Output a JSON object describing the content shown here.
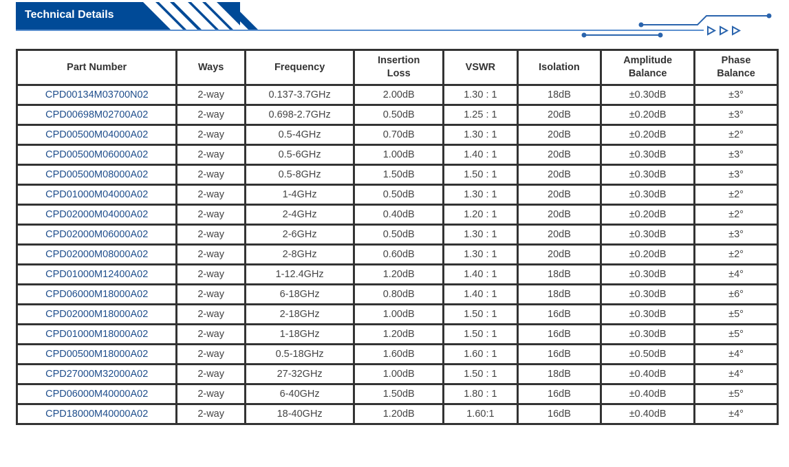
{
  "section": {
    "title": "Technical Details",
    "accent_color": "#004a97",
    "decoration_icons": [
      "stripes-decoration",
      "circuit-line-decoration",
      "triangle-arrow-icon",
      "triangle-arrow-icon",
      "triangle-arrow-icon"
    ]
  },
  "table": {
    "headers": [
      "Part  Number",
      "Ways",
      "Frequency",
      "Insertion Loss",
      "VSWR",
      "Isolation",
      "Amplitude Balance",
      "Phase Balance"
    ],
    "rows": [
      {
        "part": "CPD00134M03700N02",
        "ways": "2-way",
        "freq": "0.137-3.7GHz",
        "il": "2.00dB",
        "vswr": "1.30 : 1",
        "iso": "18dB",
        "amp": "±0.30dB",
        "phase": "±3°"
      },
      {
        "part": "CPD00698M02700A02",
        "ways": "2-way",
        "freq": "0.698-2.7GHz",
        "il": "0.50dB",
        "vswr": "1.25 : 1",
        "iso": "20dB",
        "amp": "±0.20dB",
        "phase": "±3°"
      },
      {
        "part": "CPD00500M04000A02",
        "ways": "2-way",
        "freq": "0.5-4GHz",
        "il": "0.70dB",
        "vswr": "1.30 : 1",
        "iso": "20dB",
        "amp": "±0.20dB",
        "phase": "±2°"
      },
      {
        "part": "CPD00500M06000A02",
        "ways": "2-way",
        "freq": "0.5-6GHz",
        "il": "1.00dB",
        "vswr": "1.40 : 1",
        "iso": "20dB",
        "amp": "±0.30dB",
        "phase": "±3°"
      },
      {
        "part": "CPD00500M08000A02",
        "ways": "2-way",
        "freq": "0.5-8GHz",
        "il": "1.50dB",
        "vswr": "1.50 : 1",
        "iso": "20dB",
        "amp": "±0.30dB",
        "phase": "±3°"
      },
      {
        "part": "CPD01000M04000A02",
        "ways": "2-way",
        "freq": "1-4GHz",
        "il": "0.50dB",
        "vswr": "1.30 : 1",
        "iso": "20dB",
        "amp": "±0.30dB",
        "phase": "±2°"
      },
      {
        "part": "CPD02000M04000A02",
        "ways": "2-way",
        "freq": "2-4GHz",
        "il": "0.40dB",
        "vswr": "1.20 : 1",
        "iso": "20dB",
        "amp": "±0.20dB",
        "phase": "±2°"
      },
      {
        "part": "CPD02000M06000A02",
        "ways": "2-way",
        "freq": "2-6GHz",
        "il": "0.50dB",
        "vswr": "1.30 : 1",
        "iso": "20dB",
        "amp": "±0.30dB",
        "phase": "±3°"
      },
      {
        "part": "CPD02000M08000A02",
        "ways": "2-way",
        "freq": "2-8GHz",
        "il": "0.60dB",
        "vswr": "1.30 : 1",
        "iso": "20dB",
        "amp": "±0.20dB",
        "phase": "±2°"
      },
      {
        "part": "CPD01000M12400A02",
        "ways": "2-way",
        "freq": "1-12.4GHz",
        "il": "1.20dB",
        "vswr": "1.40 : 1",
        "iso": "18dB",
        "amp": "±0.30dB",
        "phase": "±4°"
      },
      {
        "part": "CPD06000M18000A02",
        "ways": "2-way",
        "freq": "6-18GHz",
        "il": "0.80dB",
        "vswr": "1.40 : 1",
        "iso": "18dB",
        "amp": "±0.30dB",
        "phase": "±6°"
      },
      {
        "part": "CPD02000M18000A02",
        "ways": "2-way",
        "freq": "2-18GHz",
        "il": "1.00dB",
        "vswr": "1.50 : 1",
        "iso": "16dB",
        "amp": "±0.30dB",
        "phase": "±5°"
      },
      {
        "part": "CPD01000M18000A02",
        "ways": "2-way",
        "freq": "1-18GHz",
        "il": "1.20dB",
        "vswr": "1.50 : 1",
        "iso": "16dB",
        "amp": "±0.30dB",
        "phase": "±5°"
      },
      {
        "part": "CPD00500M18000A02",
        "ways": "2-way",
        "freq": "0.5-18GHz",
        "il": "1.60dB",
        "vswr": "1.60 : 1",
        "iso": "16dB",
        "amp": "±0.50dB",
        "phase": "±4°"
      },
      {
        "part": "CPD27000M32000A02",
        "ways": "2-way",
        "freq": "27-32GHz",
        "il": "1.00dB",
        "vswr": "1.50 : 1",
        "iso": "18dB",
        "amp": "±0.40dB",
        "phase": "±4°"
      },
      {
        "part": "CPD06000M40000A02",
        "ways": "2-way",
        "freq": "6-40GHz",
        "il": "1.50dB",
        "vswr": "1.80 : 1",
        "iso": "16dB",
        "amp": "±0.40dB",
        "phase": "±5°"
      },
      {
        "part": "CPD18000M40000A02",
        "ways": "2-way",
        "freq": "18-40GHz",
        "il": "1.20dB",
        "vswr": "1.60:1",
        "iso": "16dB",
        "amp": "±0.40dB",
        "phase": "±4°"
      }
    ]
  }
}
